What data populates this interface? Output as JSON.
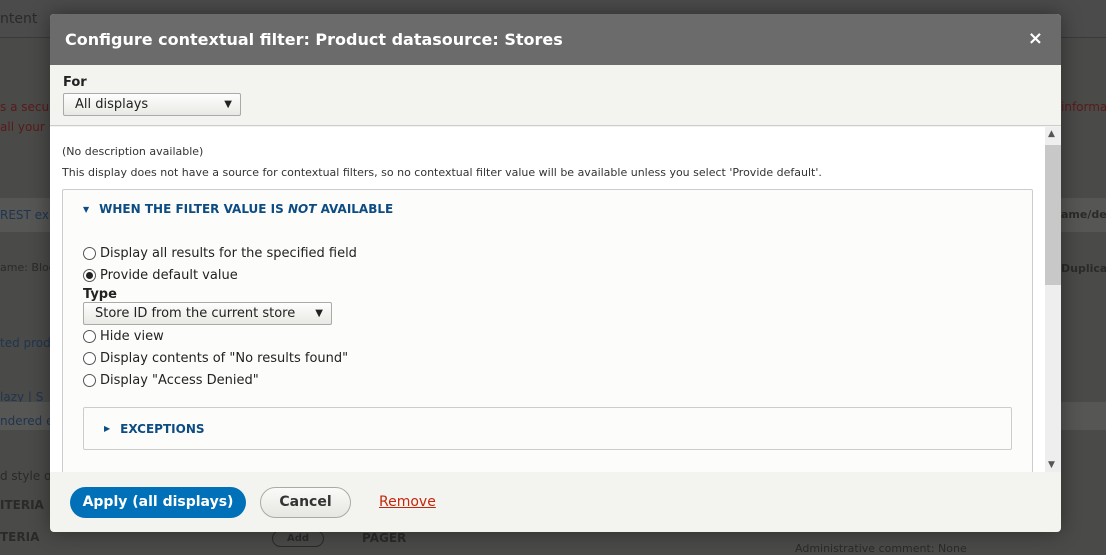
{
  "background": {
    "texts": [
      "ntent",
      "s a secu",
      "all your",
      "REST exp",
      "ame: Bloc",
      "ted prod",
      "lazy  |  S",
      "ndered en",
      "d style o",
      "ITERIA",
      "TERIA",
      "Add",
      "PAGER",
      "Administrative comment: None",
      "informa",
      "ame/desc",
      "Duplicate"
    ]
  },
  "modal": {
    "title": "Configure contextual filter: Product datasource: Stores",
    "close_label": "×",
    "for_label": "For",
    "for_value": "All displays",
    "no_description": "(No description available)",
    "notice": "This display does not have a source for contextual filters, so no contextual filter value will be available unless you select 'Provide default'.",
    "section": {
      "prefix": "WHEN THE FILTER VALUE IS ",
      "em": "NOT",
      "suffix": " AVAILABLE"
    },
    "options": [
      "Display all results for the specified field",
      "Provide default value",
      "Hide view",
      "Display contents of \"No results found\"",
      "Display \"Access Denied\""
    ],
    "selected_option": "Provide default value",
    "type_label": "Type",
    "type_value": "Store ID from the current store",
    "exceptions": "EXCEPTIONS",
    "apply": "Apply (all displays)",
    "cancel": "Cancel",
    "remove": "Remove"
  }
}
